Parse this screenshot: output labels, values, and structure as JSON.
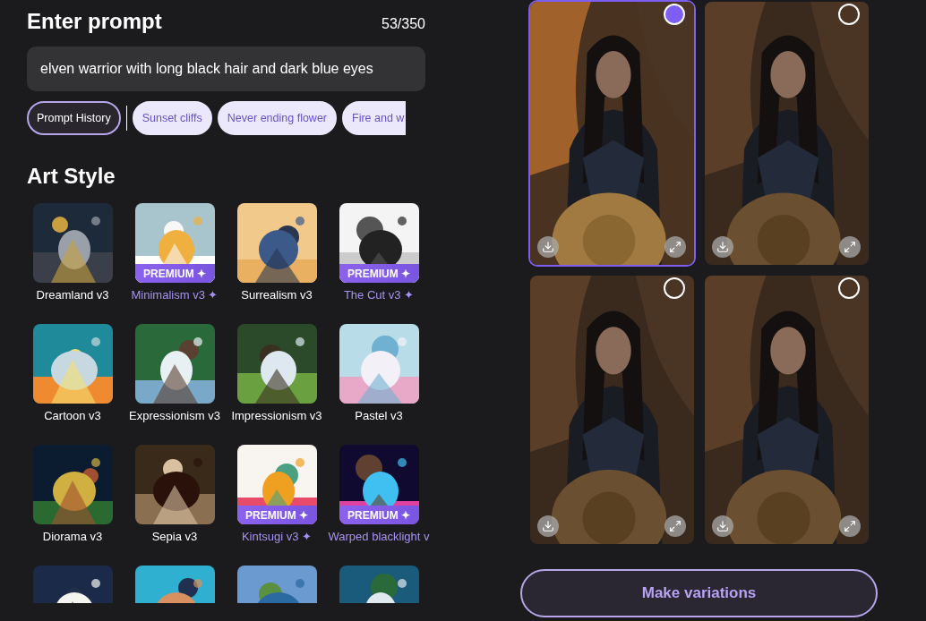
{
  "prompt": {
    "title": "Enter prompt",
    "counter": "53/350",
    "value": "elven warrior with long black hair and dark blue eyes"
  },
  "chips": [
    {
      "kind": "history",
      "label": "Prompt History"
    },
    {
      "kind": "suggestion",
      "label": "Sunset cliffs"
    },
    {
      "kind": "suggestion",
      "label": "Never ending flower"
    },
    {
      "kind": "suggestion",
      "label": "Fire and w"
    }
  ],
  "art_style": {
    "title": "Art Style",
    "styles": [
      {
        "kind": "style",
        "name": "Dreamland v3",
        "premium": false
      },
      {
        "kind": "style",
        "name": "Minimalism v3 ✦",
        "premium": true,
        "badge": "PREMIUM ✦"
      },
      {
        "kind": "style",
        "name": "Surrealism v3",
        "premium": false
      },
      {
        "kind": "style",
        "name": "The Cut v3 ✦",
        "premium": true,
        "badge": "PREMIUM ✦"
      },
      {
        "kind": "style",
        "name": "Cartoon v3",
        "premium": false
      },
      {
        "kind": "style",
        "name": "Expressionism v3",
        "premium": false
      },
      {
        "kind": "style",
        "name": "Impressionism v3",
        "premium": false
      },
      {
        "kind": "style",
        "name": "Pastel v3",
        "premium": false
      },
      {
        "kind": "style",
        "name": "Diorama v3",
        "premium": false
      },
      {
        "kind": "style",
        "name": "Sepia v3",
        "premium": false
      },
      {
        "kind": "style",
        "name": "Kintsugi v3 ✦",
        "premium": true,
        "badge": "PREMIUM ✦"
      },
      {
        "kind": "style",
        "name": "Warped blacklight v",
        "premium": true,
        "badge": "PREMIUM ✦"
      },
      {
        "kind": "picture"
      },
      {
        "kind": "picture"
      },
      {
        "kind": "picture"
      },
      {
        "kind": "picture"
      }
    ]
  },
  "results": [
    {
      "selected": true
    },
    {
      "selected": false
    },
    {
      "selected": false
    },
    {
      "selected": false
    }
  ],
  "make_variations": "Make variations"
}
